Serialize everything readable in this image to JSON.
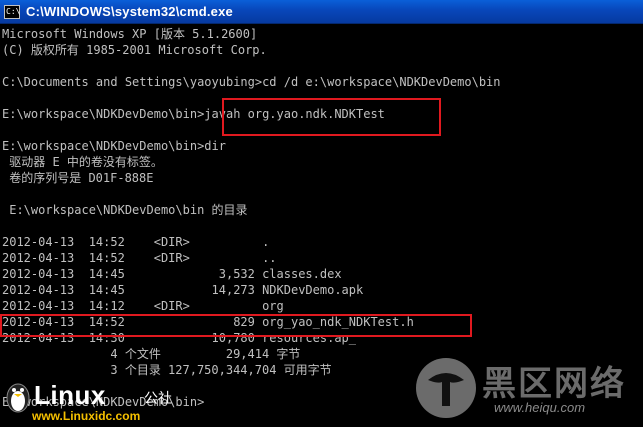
{
  "window": {
    "title": "C:\\WINDOWS\\system32\\cmd.exe",
    "icon": "cmd-icon"
  },
  "console": {
    "lines": [
      "Microsoft Windows XP [版本 5.1.2600]",
      "(C) 版权所有 1985-2001 Microsoft Corp.",
      "",
      "C:\\Documents and Settings\\yaoyubing>cd /d e:\\workspace\\NDKDevDemo\\bin",
      "",
      "E:\\workspace\\NDKDevDemo\\bin>javah org.yao.ndk.NDKTest",
      "",
      "E:\\workspace\\NDKDevDemo\\bin>dir",
      " 驱动器 E 中的卷没有标签。",
      " 卷的序列号是 D01F-888E",
      "",
      " E:\\workspace\\NDKDevDemo\\bin 的目录",
      "",
      "2012-04-13  14:52    <DIR>          .",
      "2012-04-13  14:52    <DIR>          ..",
      "2012-04-13  14:45             3,532 classes.dex",
      "2012-04-13  14:45            14,273 NDKDevDemo.apk",
      "2012-04-13  14:12    <DIR>          org",
      "2012-04-13  14:52               829 org_yao_ndk_NDKTest.h",
      "2012-04-13  14:30            10,780 resources.ap_",
      "               4 个文件         29,414 字节",
      "               3 个目录 127,750,344,704 可用字节",
      "",
      "E:\\workspace\\NDKDevDemo\\bin>"
    ]
  },
  "watermarks": {
    "linux_brand": "Linux",
    "linux_brand_cn": "公社",
    "linux_url": "www.Linuxidc.com",
    "heiqu_cn": "黑区网络",
    "heiqu_url": "www.heiqu.com"
  },
  "colors": {
    "console_text": "#c0c0c0",
    "highlight": "#e0191f",
    "titlebar": "#0846b9"
  }
}
